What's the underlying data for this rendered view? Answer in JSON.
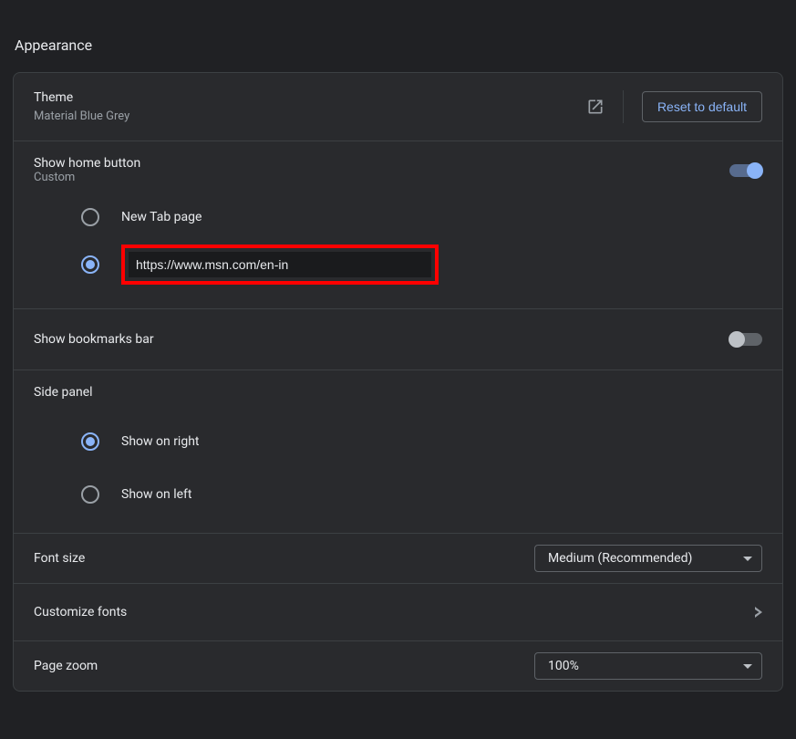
{
  "page_title": "Appearance",
  "theme": {
    "title": "Theme",
    "subtitle": "Material Blue Grey",
    "reset_button": "Reset to default"
  },
  "home_button": {
    "title": "Show home button",
    "subtitle": "Custom",
    "enabled": true,
    "options": {
      "new_tab_label": "New Tab page",
      "custom_url_value": "https://www.msn.com/en-in",
      "selected": "custom"
    }
  },
  "bookmarks_bar": {
    "title": "Show bookmarks bar",
    "enabled": false
  },
  "side_panel": {
    "title": "Side panel",
    "options": {
      "right_label": "Show on right",
      "left_label": "Show on left",
      "selected": "right"
    }
  },
  "font_size": {
    "title": "Font size",
    "value": "Medium (Recommended)"
  },
  "customize_fonts": {
    "title": "Customize fonts"
  },
  "page_zoom": {
    "title": "Page zoom",
    "value": "100%"
  }
}
